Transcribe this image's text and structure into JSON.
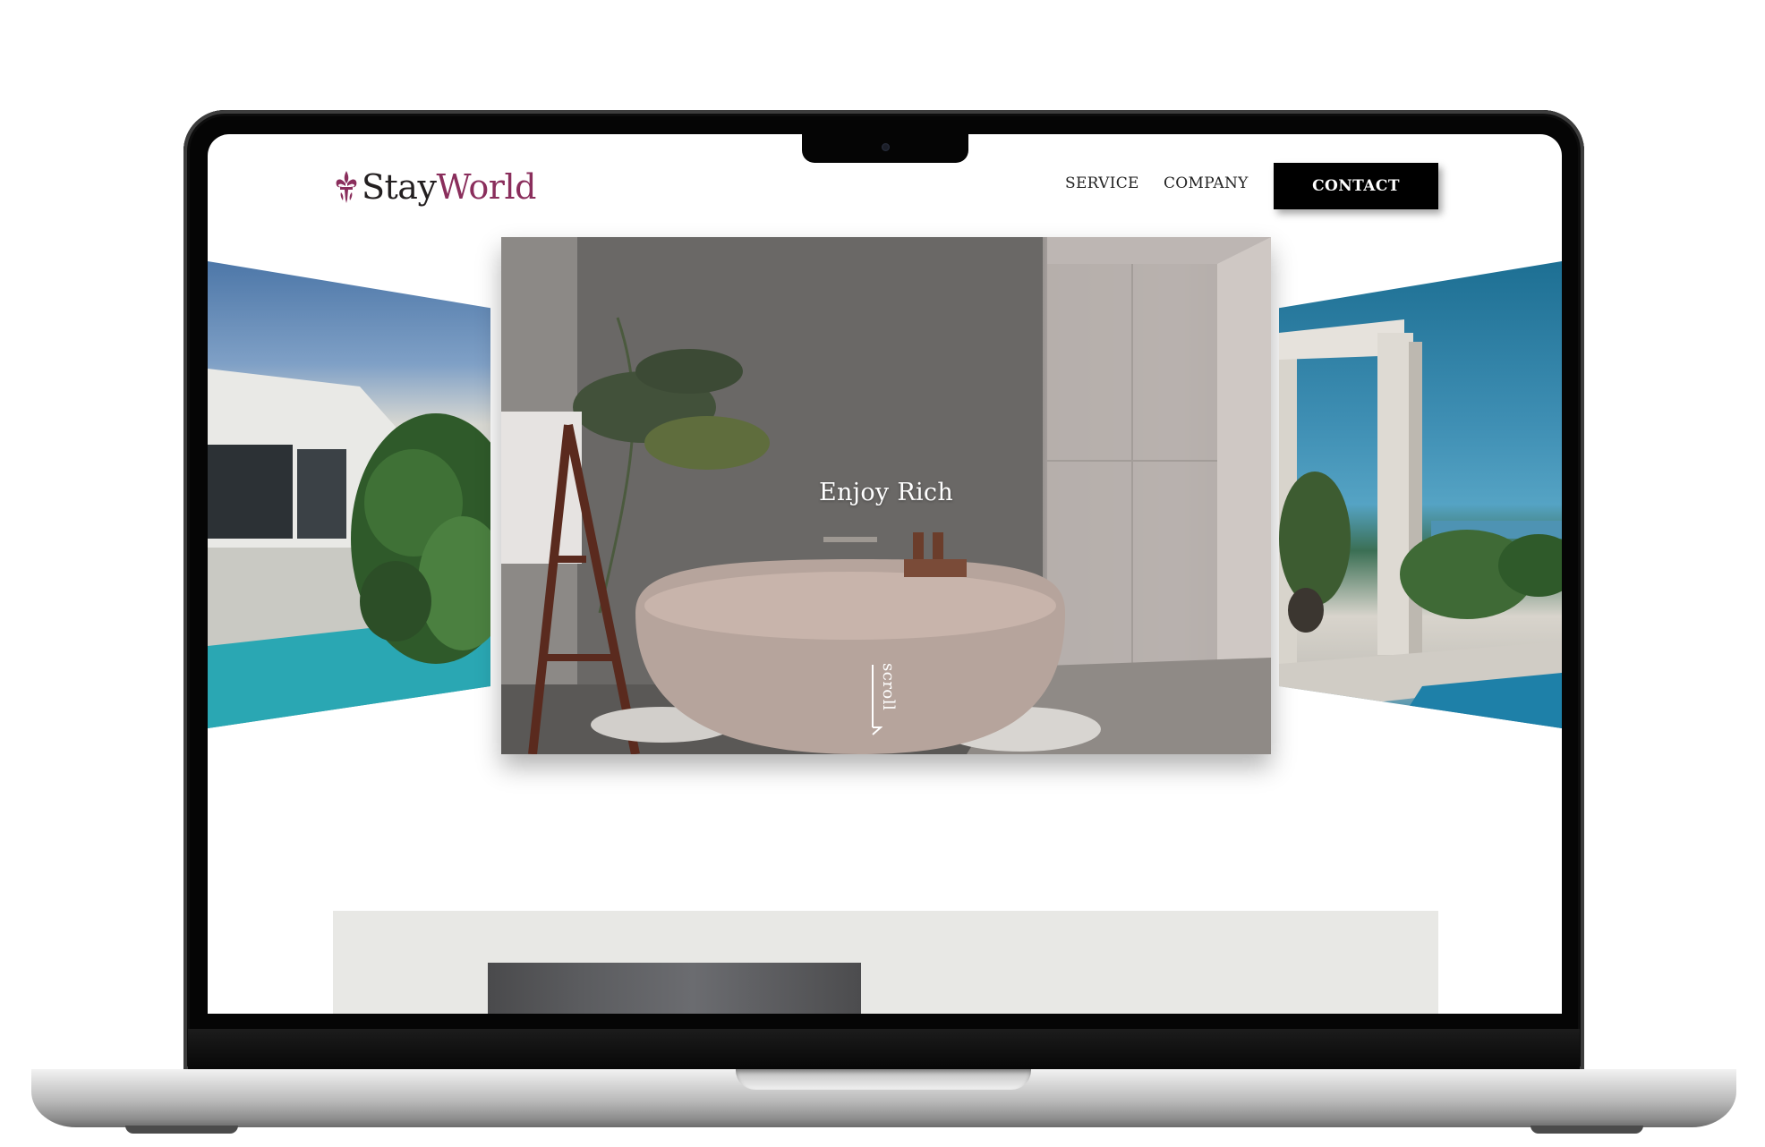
{
  "brand": {
    "name_part1": "Stay",
    "name_part2": "World",
    "accent_color": "#8a2e5c",
    "icon": "fleur-de-lis-icon"
  },
  "nav": {
    "links": [
      {
        "label": "SERVICE"
      },
      {
        "label": "COMPANY"
      }
    ],
    "contact_label": "CONTACT"
  },
  "hero": {
    "title": "Enjoy Rich",
    "scroll_label": "scroll",
    "slides": [
      {
        "subject": "modern house with poolside plants"
      },
      {
        "subject": "outdoor bathroom with stone bathtub"
      },
      {
        "subject": "infinity pool overlooking the sea"
      }
    ]
  }
}
